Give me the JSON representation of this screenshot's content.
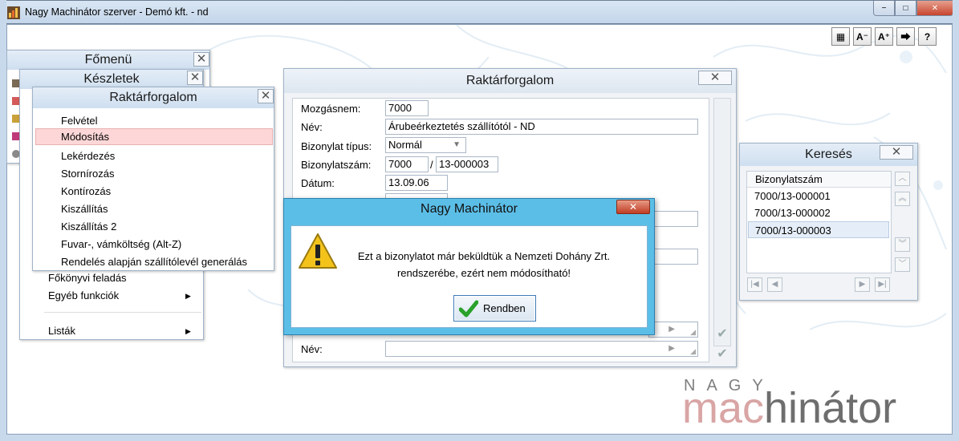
{
  "window": {
    "title": "Nagy Machinátor szerver - Demó kft. - nd",
    "btn_min": "−",
    "btn_max": "□",
    "btn_close": "✕"
  },
  "toolbar": {
    "grid": "▦",
    "font_smaller": "A⁻",
    "font_larger": "A⁺",
    "nav": "⮕",
    "help": "?"
  },
  "menus": {
    "fomenu": {
      "title": "Főmenü"
    },
    "keszletek": {
      "title": "Készletek"
    },
    "raktarforgalom": {
      "title": "Raktárforgalom",
      "items": [
        "Felvétel",
        "Módosítás",
        "Lekérdezés",
        "Stornírozás",
        "Kontírozás",
        "Kiszállítás",
        "Kiszállítás 2",
        "Fuvar-, vámköltség (Alt-Z)",
        "Rendelés alapján szállítólevél generálás"
      ],
      "selected_index": 1
    },
    "keszletek_extra": [
      "Főkönyvi feladás",
      "Egyéb funkciók",
      "Listák"
    ]
  },
  "form": {
    "title": "Raktárforgalom",
    "labels": {
      "mozgasnem": "Mozgásnem:",
      "nev": "Név:",
      "bizonylat_tipus": "Bizonylat típus:",
      "bizonylatszam": "Bizonylatszám:",
      "datum": "Dátum:",
      "nev2": "Név:"
    },
    "values": {
      "mozgasnem": "7000",
      "nev": "Árubeérkeztetés szállítótól - ND",
      "bizonylat_tipus": "Normál",
      "bizonylatszam_prefix": "7000",
      "bizonylatszam_sep": "/",
      "bizonylatszam_suffix": "13-000003",
      "datum": "13.09.06"
    }
  },
  "search": {
    "title": "Keresés",
    "column": "Bizonylatszám",
    "rows": [
      "7000/13-000001",
      "7000/13-000002",
      "7000/13-000003"
    ],
    "selected_index": 2
  },
  "dialog": {
    "title": "Nagy Machinátor",
    "message": "Ezt a bizonylatot már beküldtük a Nemzeti Dohány Zrt. rendszerébe, ezért nem módosítható!",
    "ok": "Rendben",
    "icon": "warning-icon"
  },
  "logo": {
    "top": "NAGY",
    "brand_a": "mac",
    "brand_b": "hinátor"
  },
  "colors": {
    "accent": "#5bbee7",
    "selected_row": "#fdd7d7",
    "panel_head": "#d6e4f2"
  }
}
